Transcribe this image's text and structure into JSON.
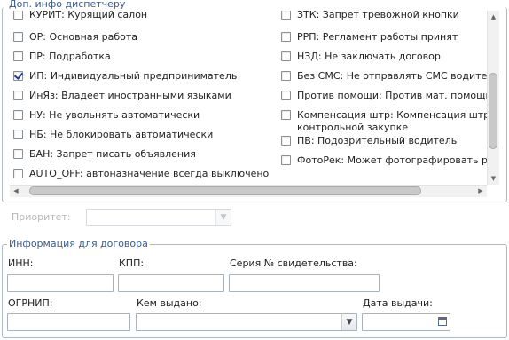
{
  "dispatcher_section": {
    "legend": "Доп. инфо диспетчеру",
    "left_column": [
      {
        "label": "КУРИТ: Курящий салон",
        "checked": false
      },
      {
        "label": "ОР: Основная работа",
        "checked": false
      },
      {
        "label": "ПР: Подработка",
        "checked": false
      },
      {
        "label": "ИП: Индивидуальный предприниматель",
        "checked": true
      },
      {
        "label": "ИнЯз: Владеет иностранными языками",
        "checked": false
      },
      {
        "label": "НУ: Не увольнять автоматически",
        "checked": false
      },
      {
        "label": "НБ: Не блокировать автоматически",
        "checked": false
      },
      {
        "label": "БАН: Запрет писать объявления",
        "checked": false
      },
      {
        "label": "AUTO_OFF: автоназначение всегда выключено",
        "checked": false
      }
    ],
    "right_column": [
      {
        "label": "ЗТК: Запрет тревожной кнопки",
        "checked": false
      },
      {
        "label": "РРП: Регламент работы принят",
        "checked": false
      },
      {
        "label": "НЗД: Не заключать договор",
        "checked": false
      },
      {
        "label": "Без СМС: Не отправлять СМС водите",
        "checked": false
      },
      {
        "label": "Против помощи: Против мат. помощи",
        "checked": false
      },
      {
        "label": "Компенсация штр: Компенсация штра контрольной закупке",
        "checked": false
      },
      {
        "label": "ПВ: Подозрительный водитель",
        "checked": false
      },
      {
        "label": "ФотоРек: Может фотографировать ре",
        "checked": false
      }
    ],
    "priority_label": "Приоритет:",
    "priority_value": ""
  },
  "contract_section": {
    "legend": "Информация для договора",
    "inn_label": "ИНН:",
    "kpp_label": "КПП:",
    "certificate_label": "Серия № свидетельства:",
    "ogrnip_label": "ОГРНИП:",
    "issued_by_label": "Кем выдано:",
    "issue_date_label": "Дата выдачи:",
    "inn_value": "",
    "kpp_value": "",
    "certificate_value": "",
    "ogrnip_value": "",
    "issued_by_value": "",
    "issue_date_value": ""
  },
  "icons": {
    "checkbox_checked": "check-icon",
    "dropdown": "chevron-down-icon",
    "calendar": "calendar-icon"
  }
}
